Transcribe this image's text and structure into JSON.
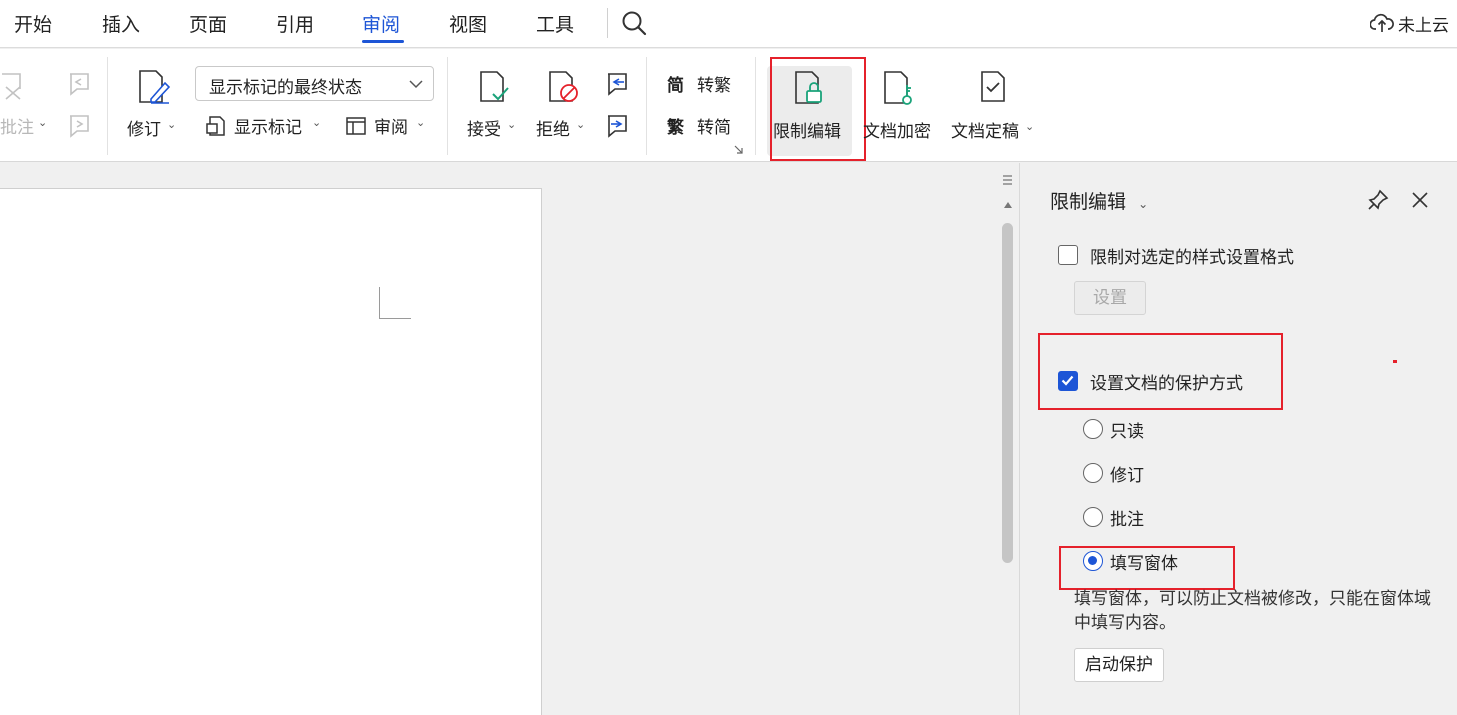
{
  "menubar": {
    "tabs": [
      "开始",
      "插入",
      "页面",
      "引用",
      "审阅",
      "视图",
      "工具"
    ],
    "active_tab": "审阅",
    "cloud_label": "未上云"
  },
  "ribbon": {
    "comment_label": "批注",
    "revise_label": "修订",
    "display_select_value": "显示标记的最终状态",
    "show_markup_label": "显示标记",
    "review_pane_label": "审阅",
    "accept_label": "接受",
    "reject_label": "拒绝",
    "to_traditional_label": "转繁",
    "to_simplified_label": "转简",
    "trad_glyph": "繁",
    "simp_glyph": "简",
    "restrict_edit_label": "限制编辑",
    "encrypt_label": "文档加密",
    "finalize_label": "文档定稿"
  },
  "panel": {
    "title": "限制编辑",
    "style_restrict": {
      "label": "限制对选定的样式设置格式",
      "checked": false
    },
    "settings_button": "设置",
    "protect_doc": {
      "label": "设置文档的保护方式",
      "checked": true
    },
    "options": [
      {
        "label": "只读",
        "selected": false
      },
      {
        "label": "修订",
        "selected": false
      },
      {
        "label": "批注",
        "selected": false
      },
      {
        "label": "填写窗体",
        "selected": true
      }
    ],
    "description": "填写窗体，可以防止文档被修改，只能在窗体域中填写内容。",
    "start_button": "启动保护"
  },
  "colors": {
    "accent": "#1d55d6",
    "highlight_box": "#e5212b",
    "lock_green": "#1aa37a"
  }
}
